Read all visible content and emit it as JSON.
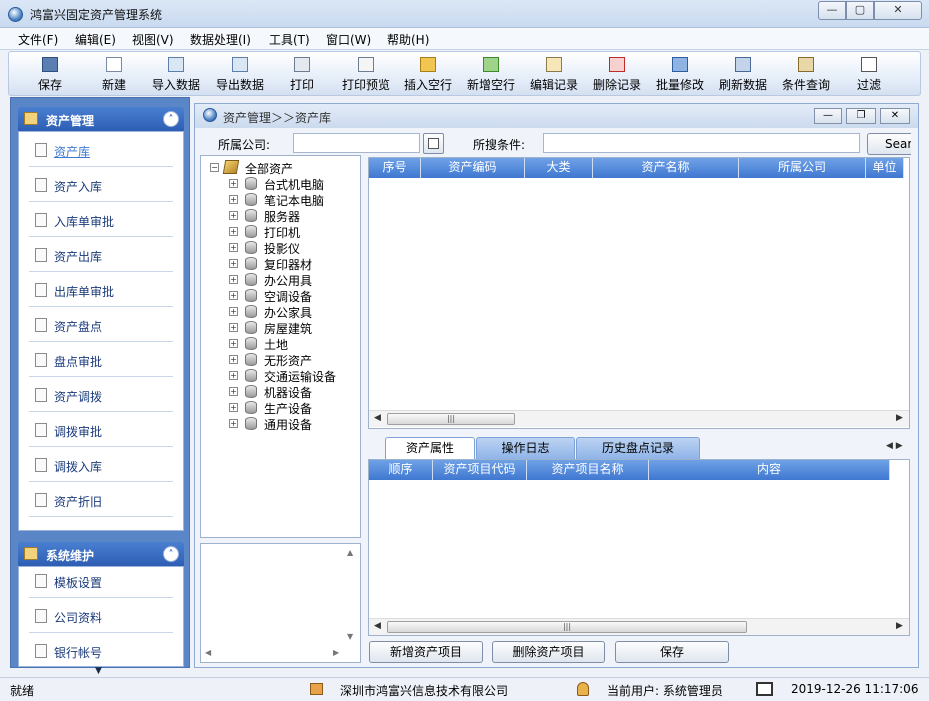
{
  "window": {
    "title": "鸿富兴固定资产管理系统",
    "min": "▭",
    "max": "▢",
    "close": "✕"
  },
  "menu": [
    "文件(F)",
    "编辑(E)",
    "视图(V)",
    "数据处理(I)",
    "工具(T)",
    "窗口(W)",
    "帮助(H)"
  ],
  "toolbar": [
    "保存",
    "新建",
    "导入数据",
    "导出数据",
    "打印",
    "打印预览",
    "插入空行",
    "新增空行",
    "编辑记录",
    "删除记录",
    "批量修改",
    "刷新数据",
    "条件查询",
    "过滤"
  ],
  "nav": {
    "asset_panel": {
      "title": "资产管理",
      "items": [
        "资产库",
        "资产入库",
        "入库单审批",
        "资产出库",
        "出库单审批",
        "资产盘点",
        "盘点审批",
        "资产调拨",
        "调拨审批",
        "调拨入库",
        "资产折旧"
      ]
    },
    "system_panel": {
      "title": "系统维护",
      "items": [
        "模板设置",
        "公司资料",
        "银行帐号"
      ]
    }
  },
  "inner": {
    "breadcrumb": "资产管理＞＞资产库",
    "company_label": "所属公司:",
    "company_value": "",
    "search_label": "所搜条件:",
    "search_value": "",
    "search_button": "Search"
  },
  "tree": {
    "root": "全部资产",
    "children": [
      "台式机电脑",
      "笔记本电脑",
      "服务器",
      "打印机",
      "投影仪",
      "复印器材",
      "办公用具",
      "空调设备",
      "办公家具",
      "房屋建筑",
      "土地",
      "无形资产",
      "交通运输设备",
      "机器设备",
      "生产设备",
      "通用设备"
    ]
  },
  "asset_grid": {
    "columns": [
      "序号",
      "资产编码",
      "大类",
      "资产名称",
      "所属公司",
      "单位"
    ]
  },
  "tabs": [
    "资产属性",
    "操作日志",
    "历史盘点记录"
  ],
  "property_grid": {
    "columns": [
      "顺序",
      "资产项目代码",
      "资产项目名称",
      "内容"
    ]
  },
  "buttons": {
    "add_item": "新增资产项目",
    "delete_item": "删除资产项目",
    "save": "保存"
  },
  "status": {
    "ready": "就绪",
    "company": "深圳市鸿富兴信息技术有限公司",
    "user": "当前用户: 系统管理员",
    "datetime": "2019-12-26 11:17:06"
  },
  "colors": {
    "nav_blue": "#5a86c8",
    "header_blue": "#3f78d2",
    "active_tab": "#3f78d2"
  }
}
